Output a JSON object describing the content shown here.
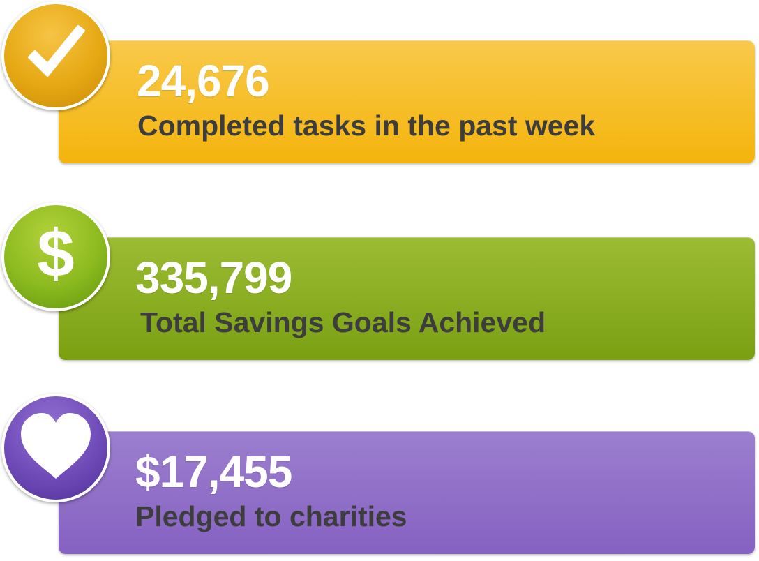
{
  "stats": [
    {
      "value": "24,676",
      "caption": "Completed tasks in the past week",
      "icon": "checkmark-icon",
      "color": "#f4b40c"
    },
    {
      "value": "335,799",
      "caption": "Total Savings Goals Achieved",
      "icon": "dollar-icon",
      "color": "#7aa012"
    },
    {
      "value": "$17,455",
      "caption": "Pledged to charities",
      "icon": "heart-icon",
      "color": "#8561c1"
    }
  ]
}
